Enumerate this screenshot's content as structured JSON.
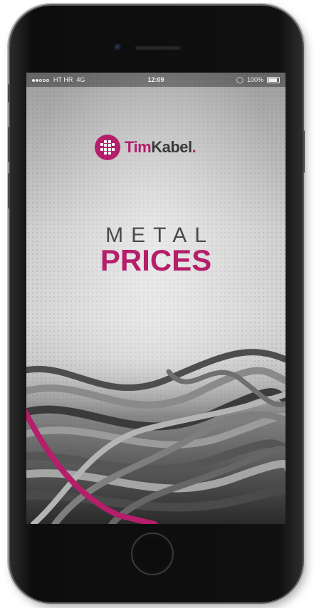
{
  "status_bar": {
    "carrier": "HT HR",
    "network": "4G",
    "time": "12:09",
    "battery": "100%"
  },
  "app": {
    "logo": {
      "brand_part1": "Tim",
      "brand_part2": "Kabel",
      "suffix": "."
    },
    "title_line1": "METAL",
    "title_line2": "PRICES"
  },
  "colors": {
    "brand": "#b51e6b",
    "text_dark": "#3a3a3a"
  },
  "icons": [
    "signal-dots-icon",
    "alarm-icon",
    "battery-icon",
    "timkabel-logo-icon",
    "home-button-icon"
  ]
}
